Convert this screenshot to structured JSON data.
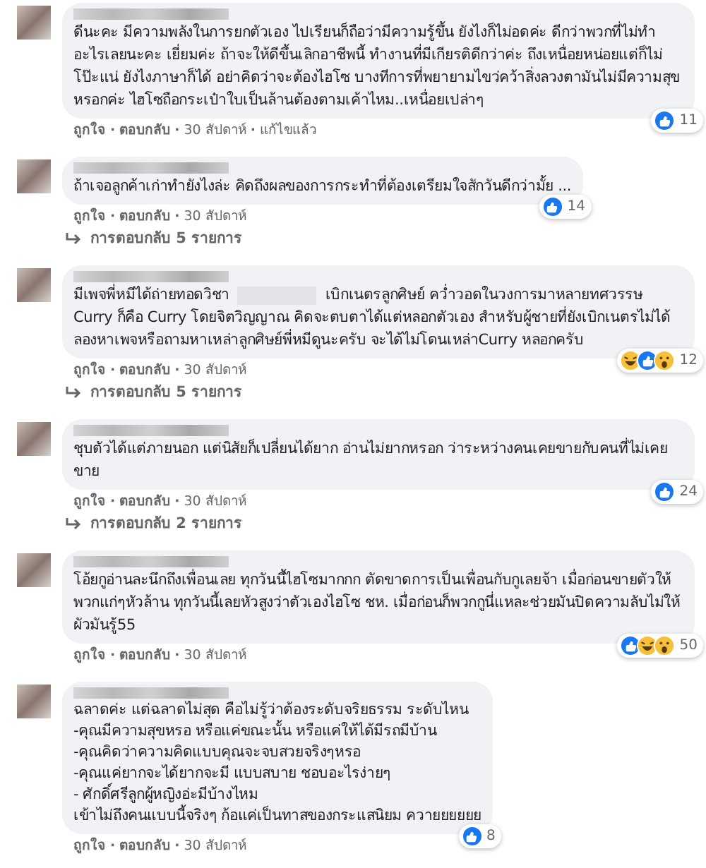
{
  "separator": "·",
  "comments": [
    {
      "segments": [
        {
          "kind": "text",
          "text": "ดีนะคะ มีความพลังในการยกตัวเอง ไปเรียนก็ถือว่ามีความรู้ขึ้น ยังไงก็ไม่อดค่ะ ดีกว่าพวกที่ไม่ทำอะไรเลยนะคะ เยี่ยมค่ะ ถ้าจะให้ดีขึ้นเลิกอาชีพนี้ ทำงานที่มีเกียรติดีกว่าค่ะ ถึงเหนื่อยหน่อยแต่ก็ไม่โป๊ะแน่ ยังไงภาษาก็ได้ อย่าคิดว่าจะต้องไฮโซ บางทีการที่พยายามไขว่คว้าสิ่งลวงตามันไม่มีความสุขหรอกค่ะ ไฮโซถือกระเป๋าใบเป็นล้านต้องตามเค้าไหม..เหนื่อยเปล่าๆ"
        }
      ],
      "reactions": [
        {
          "kind": "like"
        }
      ],
      "count": "11",
      "actions": [
        "ถูกใจ",
        "ตอบกลับ"
      ],
      "time": "30 สัปดาห์",
      "edited": "แก้ไขแล้ว"
    },
    {
      "segments": [
        {
          "kind": "text",
          "text": "ถ้าเจอลูกค้าเก่าทำยังไงล่ะ คิดถึงผลของการกระทำที่ต้องเตรียมใจสักวันดีกว่ามั้ย ..."
        }
      ],
      "reactions": [
        {
          "kind": "like"
        }
      ],
      "count": "14",
      "actions": [
        "ถูกใจ",
        "ตอบกลับ"
      ],
      "time": "30 สัปดาห์",
      "replies": "การตอบกลับ 5 รายการ"
    },
    {
      "segments": [
        {
          "kind": "text",
          "text": "มีเพจพี่หมีได้ถ่ายทอดวิชา"
        },
        {
          "kind": "redacted"
        },
        {
          "kind": "text",
          "text": "เบิกเนตรลูกศิษย์ คว่ำวอดในวงการมาหลายทศวรรษ Curry ก็คือ Curry โดยจิตวิญญาณ คิดจะตบตาได้แต่หลอกตัวเอง สำหรับผู้ชายที่ยังเบิกเนตรไม่ได้ลองหาเพจหรือถามหาเหล่าลูกศิษย์พี่หมีดูนะครับ จะได้ไม่โดนเหล่าCurry หลอกครับ"
        }
      ],
      "reactions": [
        {
          "kind": "haha"
        },
        {
          "kind": "like"
        },
        {
          "kind": "wow"
        }
      ],
      "count": "12",
      "actions": [
        "ถูกใจ",
        "ตอบกลับ"
      ],
      "time": "30 สัปดาห์",
      "replies": "การตอบกลับ 5 รายการ"
    },
    {
      "segments": [
        {
          "kind": "text",
          "text": "ชุบตัวได้แต่ภายนอก แต่นิสัยก็เปลี่ยนได้ยาก อ่านไม่ยากหรอก ว่าระหว่างคนเคยขายกับคนที่ไม่เคยขาย"
        }
      ],
      "reactions": [
        {
          "kind": "like"
        }
      ],
      "count": "24",
      "actions": [
        "ถูกใจ",
        "ตอบกลับ"
      ],
      "time": "30 สัปดาห์",
      "replies": "การตอบกลับ 2 รายการ"
    },
    {
      "segments": [
        {
          "kind": "text",
          "text": "โอ้ยกูอ่านละนึกถึงเพื่อนเลย ทุกวันนี้ไฮโซมากกก ตัดขาดการเป็นเพื่อนกับกูเลยจ้า เมื่อก่อนขายตัวให้พวกแก่ๆหัวล้าน ทุกวันนี้เลยหัวสูงว่าตัวเองไฮโซ ชห. เมื่อก่อนก็พวกกูนี่แหละช่วยมันปิดความลับไม่ให้ผัวมันรู้55"
        }
      ],
      "reactions": [
        {
          "kind": "like"
        },
        {
          "kind": "haha"
        },
        {
          "kind": "wow"
        }
      ],
      "count": "50",
      "actions": [
        "ถูกใจ",
        "ตอบกลับ"
      ],
      "time": "30 สัปดาห์"
    },
    {
      "lines": [
        "ฉลาดค่ะ แต่ฉลาดไม่สุด คือไม่รู้ว่าต้องระดับจริยธรรม ระดับไหน",
        "-คุณมีความสุขหรอ หรือแค่ขณะนั้น หรือแค่ให้ได้มีรถมีบ้าน",
        "-คุณคิดว่าความคิดแบบคุณจะจบสวยจริงๆหรอ",
        "-คุณแค่ยากจะได้ยากจะมี แบบสบาย ชอบอะไรง่ายๆ",
        "- ศักดิ์ศรีลูกผู้หญิงอ่ะมีบ้างไหม",
        "เข้าไม่ถึงคนแบบนี้จริงๆ ก้อแค่เป็นทาสของกระแสนิยม ควายยยยยย"
      ],
      "reactions": [
        {
          "kind": "like"
        }
      ],
      "count": "8",
      "actions": [
        "ถูกใจ",
        "ตอบกลับ"
      ],
      "time": "30 สัปดาห์"
    }
  ]
}
